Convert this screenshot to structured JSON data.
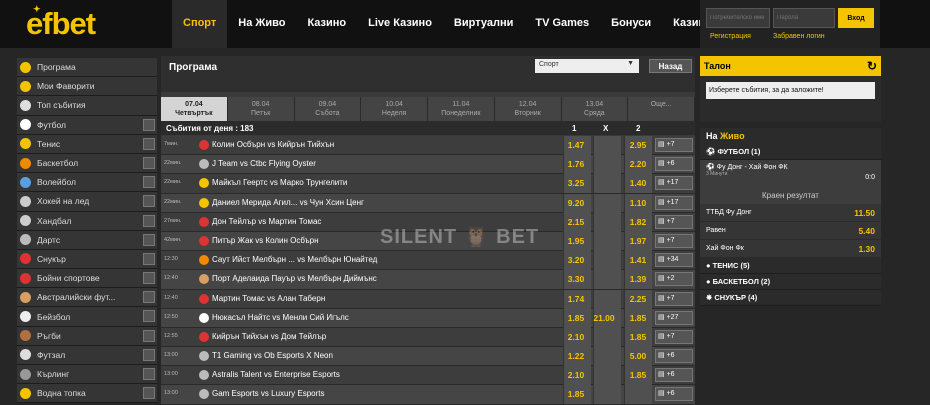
{
  "brand": {
    "logo": "efbet",
    "logo_star": "✦"
  },
  "nav": [
    "Спорт",
    "На Живо",
    "Казино",
    "Live Казино",
    "Виртуални",
    "TV Games",
    "Бонуси",
    "Казина"
  ],
  "login": {
    "user_placeholder": "Потребителско име",
    "pass_placeholder": "Парола",
    "button": "Вход",
    "register": "Регистрация",
    "forgot": "Забравен логин"
  },
  "sidebar": [
    {
      "label": "Програма",
      "icon": "calendar-icon",
      "stats": false
    },
    {
      "label": "Мои Фаворити",
      "icon": "star-icon",
      "stats": false
    },
    {
      "label": "Топ събития",
      "icon": "trophy-icon",
      "stats": false
    },
    {
      "label": "Футбол",
      "icon": "football-icon",
      "stats": true
    },
    {
      "label": "Тенис",
      "icon": "tennis-icon",
      "stats": true
    },
    {
      "label": "Баскетбол",
      "icon": "basketball-icon",
      "stats": true
    },
    {
      "label": "Волейбол",
      "icon": "volleyball-icon",
      "stats": true
    },
    {
      "label": "Хокей на лед",
      "icon": "hockey-icon",
      "stats": true
    },
    {
      "label": "Хандбал",
      "icon": "handball-icon",
      "stats": true
    },
    {
      "label": "Дартс",
      "icon": "darts-icon",
      "stats": true
    },
    {
      "label": "Снукър",
      "icon": "snooker-icon",
      "stats": true
    },
    {
      "label": "Бойни спортове",
      "icon": "boxing-icon",
      "stats": true
    },
    {
      "label": "Австралийски фут...",
      "icon": "aussie-football-icon",
      "stats": true
    },
    {
      "label": "Бейзбол",
      "icon": "baseball-icon",
      "stats": true
    },
    {
      "label": "Ръгби",
      "icon": "rugby-icon",
      "stats": true
    },
    {
      "label": "Футзал",
      "icon": "futsal-icon",
      "stats": true
    },
    {
      "label": "Кърлинг",
      "icon": "curling-icon",
      "stats": true
    },
    {
      "label": "Водна топка",
      "icon": "waterpolo-icon",
      "stats": true
    }
  ],
  "program": {
    "title": "Програма",
    "select_value": "Спорт",
    "back": "Назад",
    "dates": [
      {
        "d": "07.04",
        "w": "Четвъртък",
        "active": true
      },
      {
        "d": "08.04",
        "w": "Петък"
      },
      {
        "d": "09.04",
        "w": "Събота"
      },
      {
        "d": "10.04",
        "w": "Неделя"
      },
      {
        "d": "11.04",
        "w": "Понеделник"
      },
      {
        "d": "12.04",
        "w": "Вторник"
      },
      {
        "d": "13.04",
        "w": "Сряда"
      },
      {
        "d": "",
        "w": "Още..."
      }
    ],
    "events_label": "Събития от деня : 183",
    "col1": "1",
    "colx": "X",
    "col2": "2",
    "matches": [
      {
        "t": "7мин.",
        "live": true,
        "sport": "snooker",
        "name": "Колин Осбърн vs Кийрън Тийхън",
        "o1": "1.47",
        "ox": "",
        "o2": "2.95",
        "more": "+7"
      },
      {
        "t": "22мин.",
        "live": true,
        "sport": "esports",
        "name": "J Team vs Ctbc Flying Oyster",
        "o1": "1.76",
        "ox": "",
        "o2": "2.20",
        "more": "+6"
      },
      {
        "t": "22мин.",
        "live": true,
        "sport": "tennis",
        "name": "Майкъл Геертс vs Марко Трунгелити",
        "o1": "3.25",
        "ox": "",
        "o2": "1.40",
        "more": "+17"
      },
      {
        "t": "22мин.",
        "live": true,
        "sport": "tennis",
        "name": "Даниел Мерида Агил... vs Чун Хсин Ценг",
        "o1": "9.20",
        "ox": "",
        "o2": "1.10",
        "more": "+17"
      },
      {
        "t": "27мин.",
        "live": true,
        "sport": "snooker",
        "name": "Дон Тейлър vs Мартин Томас",
        "o1": "2.15",
        "ox": "",
        "o2": "1.82",
        "more": "+7"
      },
      {
        "t": "42мин.",
        "live": true,
        "sport": "snooker",
        "name": "Питър Жак vs Колин Осбърн",
        "o1": "1.95",
        "ox": "",
        "o2": "1.97",
        "more": "+7"
      },
      {
        "t": "12:30",
        "live": false,
        "sport": "basketball",
        "name": "Саут Ийст Мелбърн ... vs Мелбърн Юнайтед",
        "o1": "3.20",
        "ox": "",
        "o2": "1.41",
        "more": "+34"
      },
      {
        "t": "12:40",
        "live": false,
        "sport": "aussie",
        "name": "Порт Аделаида Пауър vs Мелбърн Диймънс",
        "o1": "3.30",
        "ox": "",
        "o2": "1.39",
        "more": "+2"
      },
      {
        "t": "12:40",
        "live": false,
        "sport": "snooker",
        "name": "Мартин Томас vs Алан Таберн",
        "o1": "1.74",
        "ox": "",
        "o2": "2.25",
        "more": "+7"
      },
      {
        "t": "12:50",
        "live": false,
        "sport": "football",
        "name": "Нюкасъл Найтс vs Менли Сий Игълс",
        "o1": "1.85",
        "ox": "21.00",
        "o2": "1.85",
        "more": "+27"
      },
      {
        "t": "12:55",
        "live": false,
        "sport": "snooker",
        "name": "Кийрън Тийхън vs Дом Тейлър",
        "o1": "2.10",
        "ox": "",
        "o2": "1.85",
        "more": "+7"
      },
      {
        "t": "13:00",
        "live": false,
        "sport": "esports",
        "name": "T1 Gaming vs Ob Esports X Neon",
        "o1": "1.22",
        "ox": "",
        "o2": "5.00",
        "more": "+6"
      },
      {
        "t": "13:00",
        "live": false,
        "sport": "esports",
        "name": "Astralis Talent vs Enterprise Esports",
        "o1": "2.10",
        "ox": "",
        "o2": "1.85",
        "more": "+6"
      },
      {
        "t": "13:00",
        "live": false,
        "sport": "esports",
        "name": "Gam Esports vs Luxury Esports",
        "o1": "1.85",
        "ox": "",
        "o2": "",
        "more": "+6"
      }
    ]
  },
  "watermark": "SILENT 🦉 BET",
  "betslip": {
    "title": "Талон",
    "icon": "refresh-icon",
    "message": "Изберете събития, за да заложите!"
  },
  "live": {
    "title_prefix": "На ",
    "title_word": "Живо",
    "football": "ФУТБОЛ (1)",
    "match": "Фу Донг - Хай Фон ФК",
    "minute": "3 Минути",
    "score": "0:0",
    "market": "Краен резултат",
    "outcomes": [
      {
        "label": "ТТБД Фу Донг",
        "odd": "11.50"
      },
      {
        "label": "Равен",
        "odd": "5.40"
      },
      {
        "label": "Хай Фон Фк",
        "odd": "1.30"
      }
    ],
    "tennis": "ТЕНИС (5)",
    "basketball": "БАСКЕТБОЛ (2)",
    "snooker": "СНУКЪР (4)"
  },
  "colors": {
    "accent": "#f5c400",
    "bg": "#262626"
  }
}
